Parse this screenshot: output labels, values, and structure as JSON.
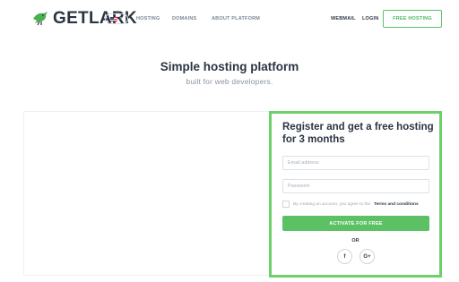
{
  "header": {
    "logo_text": "GETLARK",
    "language": "US",
    "nav": [
      "HOSTING",
      "DOMAINS",
      "ABOUT PLATFORM"
    ],
    "webmail": "WEBMAIL",
    "login": "LOGIN",
    "cta": "FREE HOSTING"
  },
  "hero": {
    "title": "Simple hosting platform",
    "subtitle": "built for web developers."
  },
  "register": {
    "title": "Register and get a free hosting for 3 months",
    "email_placeholder": "Email address",
    "password_placeholder": "Password",
    "consent_text": "By creating an account, you agree to the",
    "consent_link": "Terms and conditions",
    "activate": "ACTIVATE FOR FREE",
    "or": "OR",
    "social": [
      "f",
      "G+"
    ]
  },
  "colors": {
    "accent": "#5cc165",
    "card_border": "#6fcf6b",
    "text_dark": "#2b3542",
    "text_muted": "#8a949f"
  },
  "icons": [
    "lark-bird-icon",
    "us-flag-icon",
    "chevron-down-icon",
    "facebook-icon",
    "google-plus-icon"
  ]
}
